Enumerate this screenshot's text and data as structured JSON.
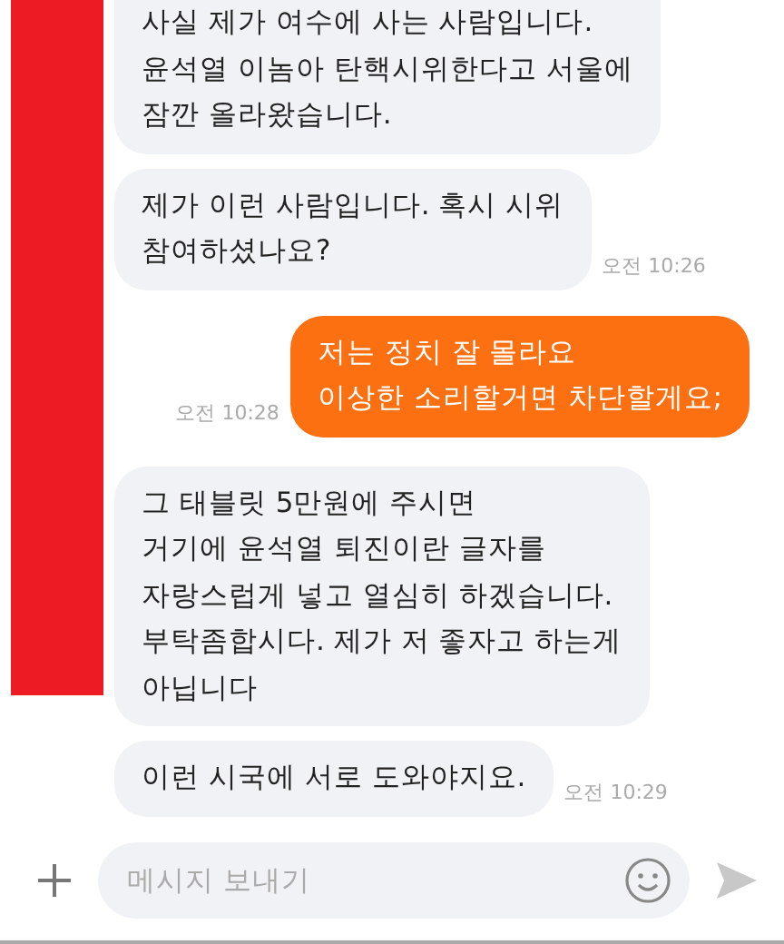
{
  "messages": [
    {
      "kind": "in",
      "text": "사실 제가 여수에 사는 사람입니다.\n윤석열 이놈아 탄핵시위한다고 서울에\n잠깐 올라왔습니다."
    },
    {
      "kind": "in",
      "text": "제가 이런 사람입니다. 혹시 시위\n참여하셨나요?",
      "time": "오전 10:26"
    },
    {
      "kind": "out",
      "text": "저는 정치 잘 몰라요\n이상한 소리할거면 차단할게요;",
      "time": "오전 10:28"
    },
    {
      "kind": "in",
      "text": "그 태블릿 5만원에 주시면\n거기에 윤석열 퇴진이란 글자를\n자랑스럽게 넣고 열심히 하겠습니다.\n부탁좀합시다. 제가 저 좋자고 하는게\n아닙니다"
    },
    {
      "kind": "in",
      "text": "이런 시국에 서로 도와야지요.",
      "time": "오전 10:29"
    }
  ],
  "composer": {
    "placeholder": "메시지 보내기"
  }
}
